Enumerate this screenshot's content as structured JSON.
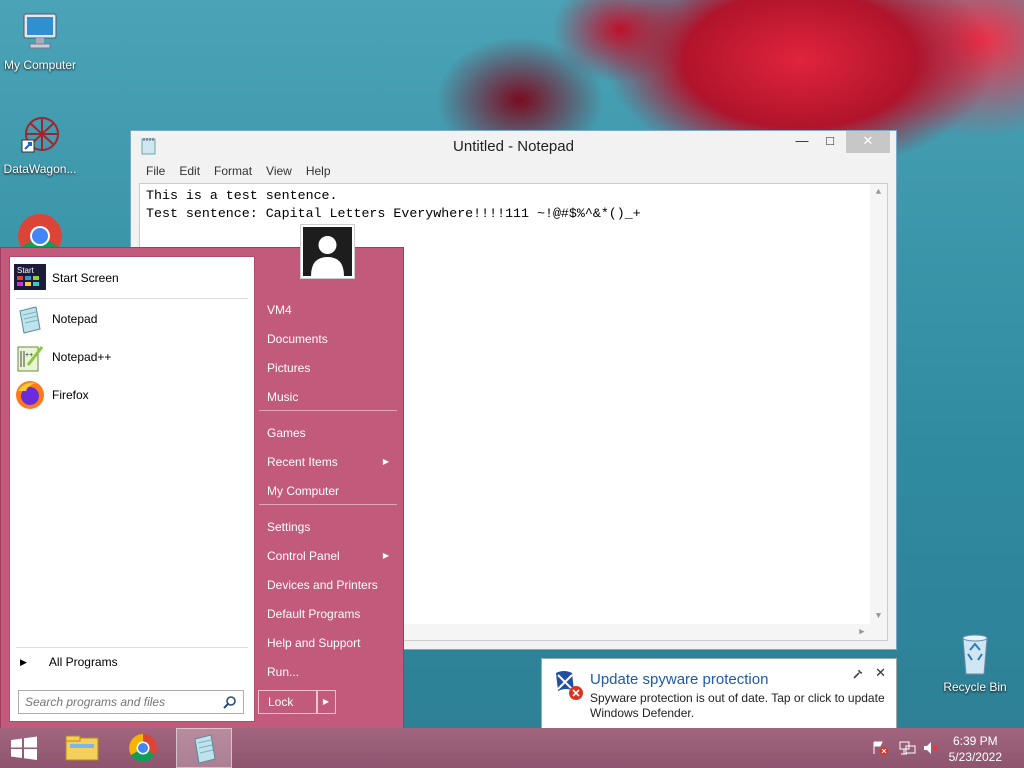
{
  "desktop": {
    "icons": [
      {
        "label": "My Computer"
      },
      {
        "label": "DataWagon..."
      },
      {
        "label": "Recycle Bin"
      }
    ]
  },
  "notepad": {
    "title": "Untitled - Notepad",
    "menus": [
      "File",
      "Edit",
      "Format",
      "View",
      "Help"
    ],
    "lines": [
      "This is a test sentence.",
      "Test sentence: Capital Letters Everywhere!!!!111 ~!@#$%^&*()_+"
    ],
    "controls": {
      "minimize": "—",
      "maximize": "□",
      "close": "✕"
    }
  },
  "start_menu": {
    "pinned": [
      {
        "label": "Start Screen",
        "icon": "start-screen-icon"
      },
      {
        "label": "Notepad",
        "icon": "notepad-icon"
      },
      {
        "label": "Notepad++",
        "icon": "notepadpp-icon"
      },
      {
        "label": "Firefox",
        "icon": "firefox-icon"
      }
    ],
    "all_programs": "All Programs",
    "search_placeholder": "Search programs and files",
    "right_links": [
      {
        "label": "VM4"
      },
      {
        "label": "Documents"
      },
      {
        "label": "Pictures"
      },
      {
        "label": "Music"
      },
      {
        "label": "Games"
      },
      {
        "label": "Recent Items",
        "submenu": true
      },
      {
        "label": "My Computer"
      },
      {
        "label": "Settings"
      },
      {
        "label": "Control Panel",
        "submenu": true
      },
      {
        "label": "Devices and Printers"
      },
      {
        "label": "Default Programs"
      },
      {
        "label": "Help and Support"
      },
      {
        "label": "Run..."
      }
    ],
    "lock_label": "Lock",
    "start_tile_text": "Start"
  },
  "notification": {
    "title": "Update spyware protection",
    "body": "Spyware protection is out of date. Tap or click to update Windows Defender."
  },
  "taskbar": {
    "time": "6:39 PM",
    "date": "5/23/2022",
    "apps": [
      "file-explorer-icon",
      "chrome-icon",
      "notepad-icon"
    ]
  },
  "colors": {
    "start_menu_bg": "#c25a7c",
    "taskbar_bg": "#9a5f79",
    "notification_title": "#1e5aa8"
  }
}
